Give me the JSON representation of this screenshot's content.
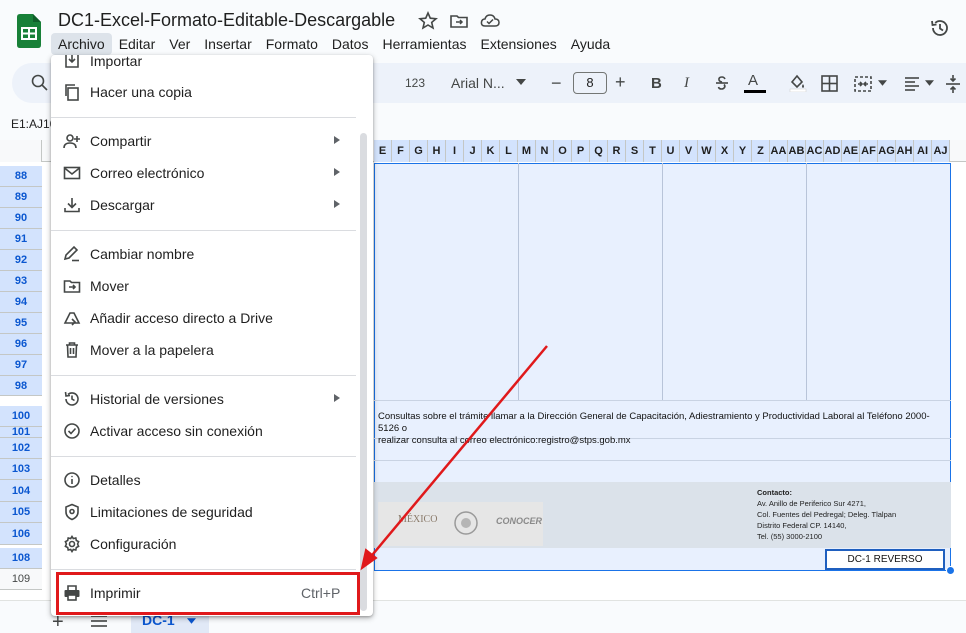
{
  "document": {
    "title": "DC1-Excel-Formato-Editable-Descargable"
  },
  "menubar": [
    {
      "label": "Archivo",
      "active": true
    },
    {
      "label": "Editar"
    },
    {
      "label": "Ver"
    },
    {
      "label": "Insertar"
    },
    {
      "label": "Formato"
    },
    {
      "label": "Datos"
    },
    {
      "label": "Herramientas"
    },
    {
      "label": "Extensiones"
    },
    {
      "label": "Ayuda"
    }
  ],
  "toolbar": {
    "format_123": "123",
    "font_name": "Arial N...",
    "font_size": "8",
    "decrease": "−",
    "increase": "+"
  },
  "namebox": {
    "value": "E1:AJ10"
  },
  "columns": [
    "E",
    "F",
    "G",
    "H",
    "I",
    "J",
    "K",
    "L",
    "M",
    "N",
    "O",
    "P",
    "Q",
    "R",
    "S",
    "T",
    "U",
    "V",
    "W",
    "X",
    "Y",
    "Z",
    "AA",
    "AB",
    "AC",
    "AD",
    "AE",
    "AF",
    "AG",
    "AH",
    "AI",
    "AJ"
  ],
  "rows": [
    "88",
    "89",
    "90",
    "91",
    "92",
    "93",
    "94",
    "95",
    "96",
    "97",
    "98",
    "100",
    "101",
    "102",
    "103",
    "104",
    "105",
    "106",
    "108",
    "109"
  ],
  "sheet_content": {
    "info_line1": "Consultas sobre el trámite llamar a la Dirección General de Capacitación, Adiestramiento y Productividad Laboral al Teléfono 2000-5126 o",
    "info_line2": "realizar consulta al correo electrónico:registro@stps.gob.mx",
    "contact_title": "Contacto:",
    "contact_lines": [
      "Av. Anillo de Periferico Sur 4271,",
      "Col. Fuentes del Pedregal; Deleg. Tlalpan",
      "Distrito Federal CP. 14140,",
      "Tel. (55) 3000-2100"
    ],
    "logo_text_mexico": "MÉXICO",
    "logo_text_conocer": "CONOCER",
    "dc_label": "DC-1 REVERSO"
  },
  "file_menu": {
    "items": [
      {
        "label": "Importar",
        "icon": "import-icon"
      },
      {
        "label": "Hacer una copia",
        "icon": "copy-icon"
      },
      {
        "label": "Compartir",
        "icon": "share-person-icon",
        "submenu": true
      },
      {
        "label": "Correo electrónico",
        "icon": "email-icon",
        "submenu": true
      },
      {
        "label": "Descargar",
        "icon": "download-icon",
        "submenu": true
      },
      {
        "label": "Cambiar nombre",
        "icon": "rename-icon"
      },
      {
        "label": "Mover",
        "icon": "move-folder-icon"
      },
      {
        "label": "Añadir acceso directo a Drive",
        "icon": "drive-shortcut-icon"
      },
      {
        "label": "Mover a la papelera",
        "icon": "trash-icon"
      },
      {
        "label": "Historial de versiones",
        "icon": "history-icon",
        "submenu": true
      },
      {
        "label": "Activar acceso sin conexión",
        "icon": "offline-icon"
      },
      {
        "label": "Detalles",
        "icon": "info-icon"
      },
      {
        "label": "Limitaciones de seguridad",
        "icon": "security-icon"
      },
      {
        "label": "Configuración",
        "icon": "gear-icon"
      },
      {
        "label": "Imprimir",
        "icon": "print-icon",
        "shortcut": "Ctrl+P"
      }
    ]
  },
  "sheet_tabs": [
    {
      "label": "DC-1",
      "active": true
    }
  ],
  "colors": {
    "accent": "#0b57d0",
    "annotation_red": "#e0191b",
    "sheets_green": "#188038"
  }
}
